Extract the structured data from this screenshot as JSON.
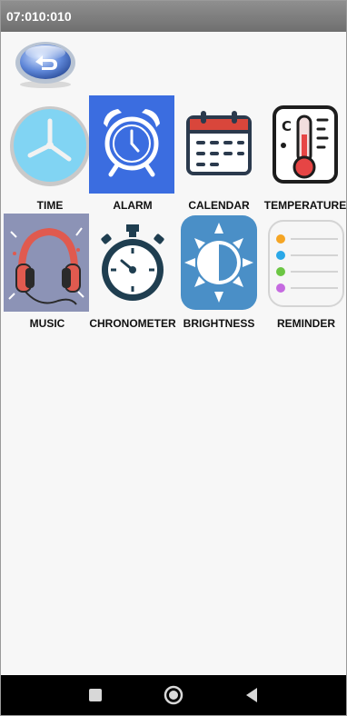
{
  "status_bar": {
    "time": "07:010:010"
  },
  "apps": [
    {
      "label": "TIME",
      "icon": "clock-icon"
    },
    {
      "label": "ALARM",
      "icon": "alarm-clock-icon"
    },
    {
      "label": "CALENDAR",
      "icon": "calendar-icon"
    },
    {
      "label": "TEMPERATURE",
      "icon": "thermometer-icon"
    },
    {
      "label": "MUSIC",
      "icon": "headphones-icon"
    },
    {
      "label": "CHRONOMETER",
      "icon": "stopwatch-icon"
    },
    {
      "label": "BRIGHTNESS",
      "icon": "brightness-icon"
    },
    {
      "label": "REMINDER",
      "icon": "reminder-list-icon"
    }
  ],
  "colors": {
    "status_bar": "#7a7a7a",
    "alarm_bg": "#3b6de0",
    "brightness_bg": "#4a8fc7",
    "music_bg": "#8c93b6",
    "calendar_red": "#d9463b",
    "nav_bar": "#000000"
  },
  "navigation": [
    "square-icon",
    "circle-icon",
    "triangle-back-icon"
  ]
}
